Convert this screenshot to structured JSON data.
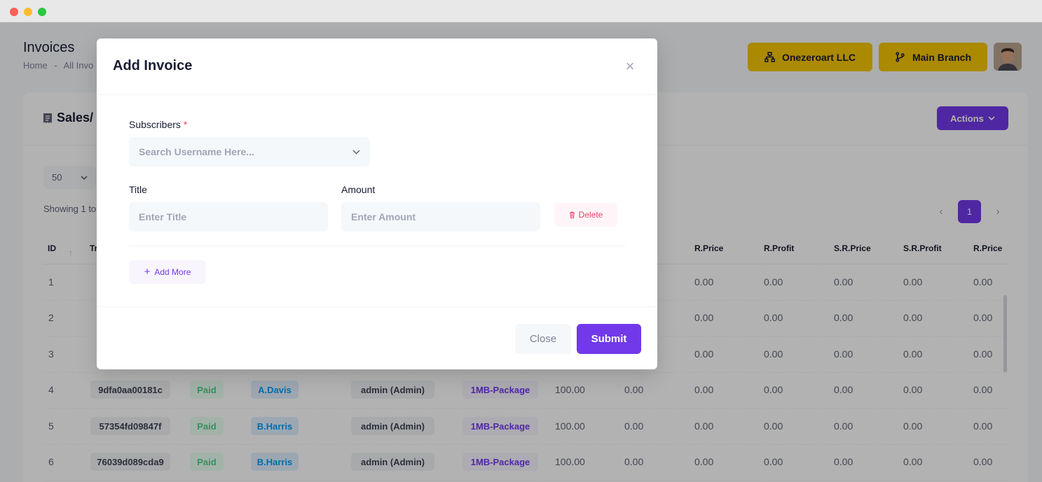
{
  "page": {
    "title": "Invoices",
    "breadcrumb": [
      "Home",
      "-",
      "All Invo"
    ]
  },
  "header": {
    "org_label": "Onezeroart LLC",
    "branch_label": "Main Branch",
    "org_icon": "sitemap-icon",
    "branch_icon": "code-branch-icon"
  },
  "card": {
    "title": "Sales/",
    "actions_label": "Actions",
    "per_page": "50",
    "showing": "Showing 1 to",
    "current_page": "1"
  },
  "table": {
    "headers": [
      "ID",
      "Tr",
      "R.Price",
      "R.Profit",
      "S.R.Price",
      "S.R.Profit",
      "R.Price"
    ],
    "rows": [
      {
        "id": "1",
        "trx": "",
        "status": "",
        "user": "",
        "by": "",
        "pkg": "",
        "price": "",
        "profit": "",
        "rprice": "0.00",
        "rprofit": "0.00",
        "srprice": "0.00",
        "srprofit": "0.00",
        "rprice2": "0.00"
      },
      {
        "id": "2",
        "trx": "",
        "status": "",
        "user": "",
        "by": "",
        "pkg": "",
        "price": "",
        "profit": "",
        "rprice": "0.00",
        "rprofit": "0.00",
        "srprice": "0.00",
        "srprofit": "0.00",
        "rprice2": "0.00"
      },
      {
        "id": "3",
        "trx": "",
        "status": "",
        "user": "",
        "by": "",
        "pkg": "",
        "price": "",
        "profit": "",
        "rprice": "0.00",
        "rprofit": "0.00",
        "srprice": "0.00",
        "srprofit": "0.00",
        "rprice2": "0.00"
      },
      {
        "id": "4",
        "trx": "9dfa0aa00181c",
        "status": "Paid",
        "user": "A.Davis",
        "by": "admin (Admin)",
        "pkg": "1MB-Package",
        "price": "100.00",
        "profit": "0.00",
        "rprice": "0.00",
        "rprofit": "0.00",
        "srprice": "0.00",
        "srprofit": "0.00",
        "rprice2": "0.00"
      },
      {
        "id": "5",
        "trx": "57354fd09847f",
        "status": "Paid",
        "user": "B.Harris",
        "by": "admin (Admin)",
        "pkg": "1MB-Package",
        "price": "100.00",
        "profit": "0.00",
        "rprice": "0.00",
        "rprofit": "0.00",
        "srprice": "0.00",
        "srprofit": "0.00",
        "rprice2": "0.00"
      },
      {
        "id": "6",
        "trx": "76039d089cda9",
        "status": "Paid",
        "user": "B.Harris",
        "by": "admin (Admin)",
        "pkg": "1MB-Package",
        "price": "100.00",
        "profit": "0.00",
        "rprice": "0.00",
        "rprofit": "0.00",
        "srprice": "0.00",
        "srprofit": "0.00",
        "rprice2": "0.00"
      }
    ]
  },
  "modal": {
    "title": "Add Invoice",
    "subscribers_label": "Subscribers",
    "required_mark": "*",
    "subscribers_placeholder": "Search Username Here...",
    "title_label": "Title",
    "title_placeholder": "Enter Title",
    "amount_label": "Amount",
    "amount_placeholder": "Enter Amount",
    "delete_label": "Delete",
    "add_more_label": "Add More",
    "close_label": "Close",
    "submit_label": "Submit"
  },
  "colors": {
    "primary": "#7239ea",
    "header_button": "#f5c400",
    "danger": "#f1416c",
    "success": "#50cd89",
    "info": "#009ef7"
  }
}
